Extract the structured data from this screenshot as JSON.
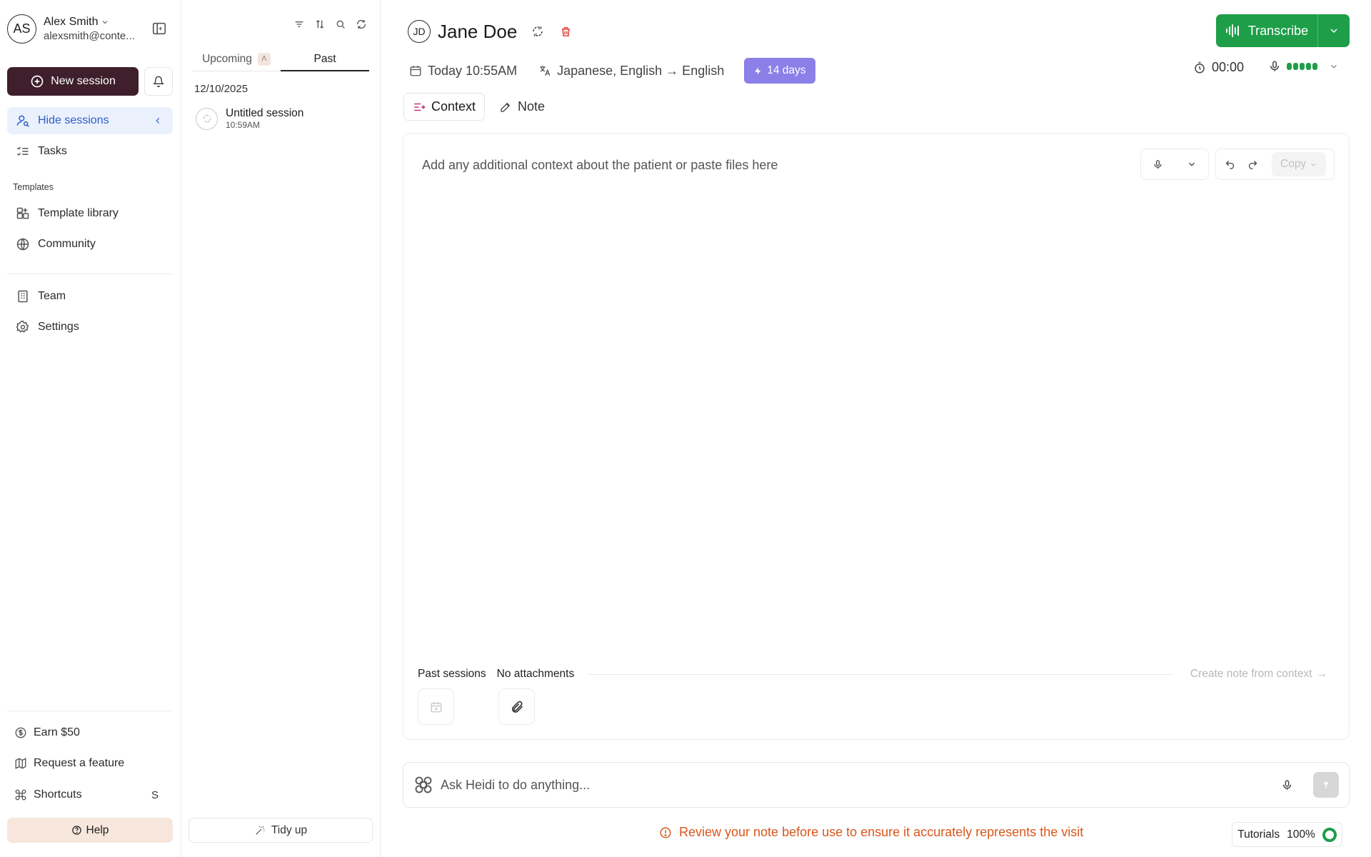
{
  "user": {
    "initials": "AS",
    "name": "Alex Smith",
    "email": "alexsmith@conte..."
  },
  "sidebar": {
    "new_session_label": "New session",
    "nav": [
      {
        "label": "Hide sessions"
      },
      {
        "label": "Tasks"
      }
    ],
    "templates_heading": "Templates",
    "templates": [
      {
        "label": "Template library"
      },
      {
        "label": "Community"
      }
    ],
    "org": [
      {
        "label": "Team"
      },
      {
        "label": "Settings"
      }
    ],
    "bottom": [
      {
        "label": "Earn $50"
      },
      {
        "label": "Request a feature"
      },
      {
        "label": "Shortcuts",
        "key": "S"
      }
    ],
    "help_label": "Help"
  },
  "sessions": {
    "tabs": [
      {
        "label": "Upcoming",
        "badge": "Λ"
      },
      {
        "label": "Past"
      }
    ],
    "date_group": "12/10/2025",
    "items": [
      {
        "title": "Untitled session",
        "time": "10:59AM"
      }
    ],
    "tidy_label": "Tidy up"
  },
  "main": {
    "patient_initials": "JD",
    "patient_name": "Jane Doe",
    "date": "Today 10:55AM",
    "language": "Japanese, English → English",
    "trial_badge": "14 days",
    "transcribe_label": "Transcribe",
    "timer": "00:00",
    "mic_level": 1.0,
    "view_tabs": [
      {
        "label": "Context"
      },
      {
        "label": "Note"
      }
    ],
    "editor_placeholder": "Add any additional context about the patient or paste files here",
    "copy_label": "Copy",
    "past_sessions_label": "Past sessions",
    "attachments_label": "No attachments",
    "create_note_label": "Create note from context",
    "create_note_arrow": "→",
    "ask_placeholder": "Ask Heidi to do anything...",
    "warning": "Review your note before use to ensure it accurately represents the visit",
    "tutorials_label": "Tutorials",
    "tutorials_progress": "100%"
  },
  "colors": {
    "primary": "#3e1f2b",
    "active_nav_bg": "#eaf1fd",
    "active_nav_text": "#2d5ec8",
    "transcribe": "#1e9e48",
    "trial_badge": "#8c7fe8",
    "warning": "#d9561b",
    "help_bg": "#f6e6dc"
  }
}
